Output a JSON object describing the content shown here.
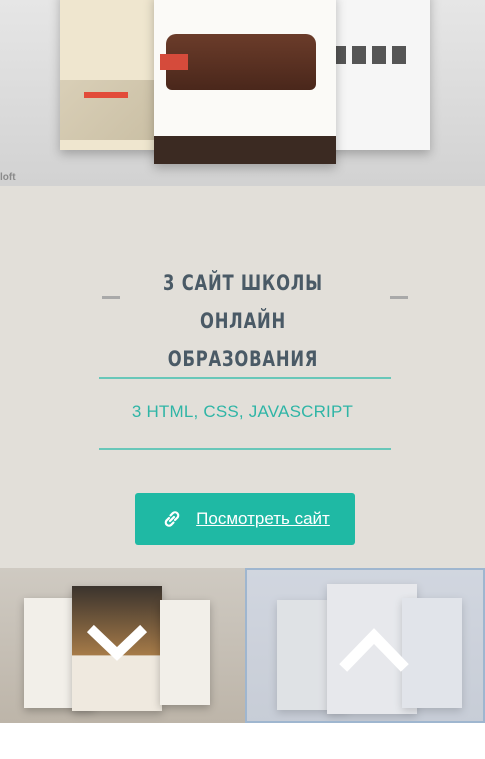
{
  "hero": {
    "watermark": "loft"
  },
  "project": {
    "title": "3 Сайт школы онлайн образования",
    "tech": "3 HTML, CSS, JAVASCRIPT",
    "cta_label": "Посмотреть сайт"
  },
  "thumbnails": [
    {
      "arrow": "chevron-down"
    },
    {
      "arrow": "chevron-up"
    }
  ],
  "colors": {
    "accent": "#1fb9a4",
    "accent_text": "#2fb5a6",
    "title": "#4a5a66",
    "section_bg": "#e2dfd9",
    "rule": "#68c7b9"
  }
}
